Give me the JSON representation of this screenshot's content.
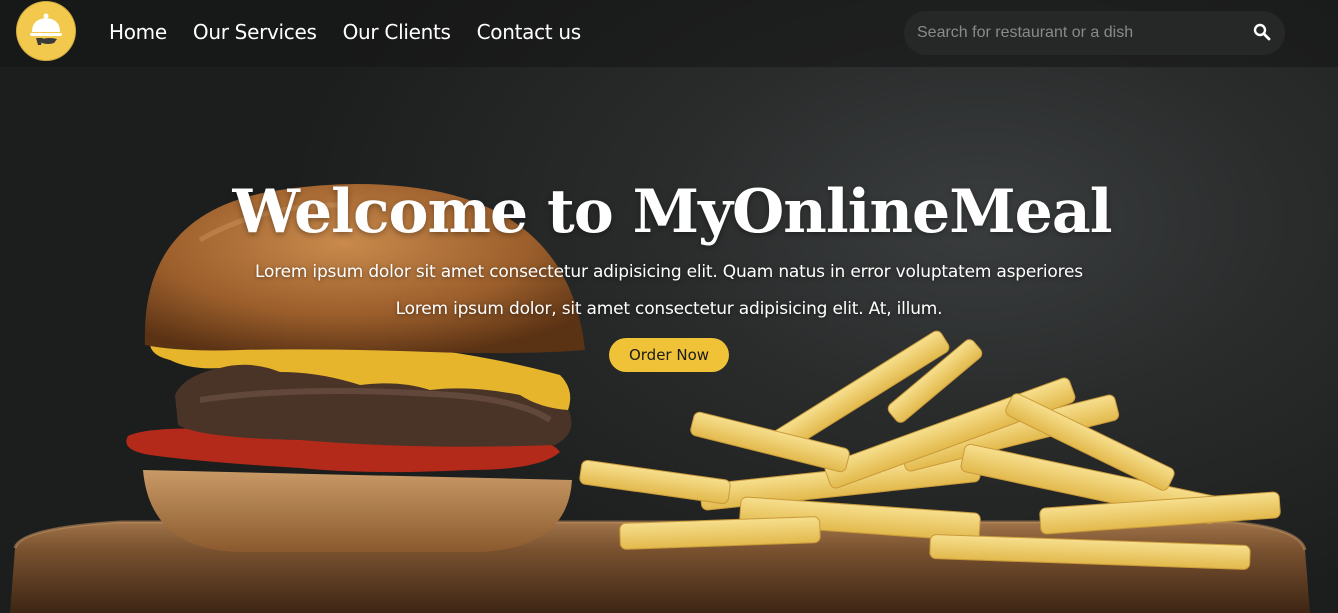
{
  "navbar": {
    "logo_icon": "cloche-serving-icon",
    "links": [
      {
        "label": "Home"
      },
      {
        "label": "Our Services"
      },
      {
        "label": "Our Clients"
      },
      {
        "label": "Contact us"
      }
    ],
    "search": {
      "placeholder": "Search for restaurant or a dish",
      "value": "",
      "icon": "search-icon"
    }
  },
  "hero": {
    "title": "Welcome to MyOnlineMeal",
    "line1": "Lorem ipsum dolor sit amet consectetur adipisicing elit. Quam natus in error voluptatem asperiores",
    "line2": "Lorem ipsum dolor, sit amet consectetur adipisicing elit. At, illum.",
    "cta_label": "Order Now"
  },
  "colors": {
    "accent": "#f0c238",
    "logo_bg": "#f2c94c",
    "navbar_bg": "#141414",
    "search_bg": "#262727"
  }
}
